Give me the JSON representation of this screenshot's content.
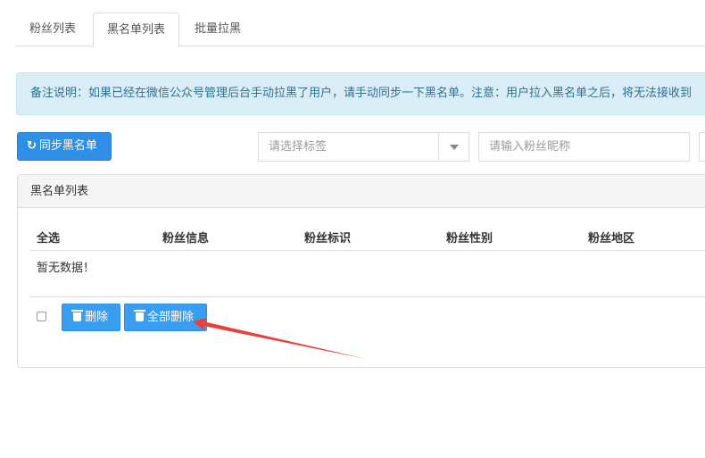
{
  "tabs": [
    {
      "label": "粉丝列表",
      "active": false
    },
    {
      "label": "黑名单列表",
      "active": true
    },
    {
      "label": "批量拉黑",
      "active": false
    }
  ],
  "notice": {
    "text": "备注说明：如果已经在微信公众号管理后台手动拉黑了用户，请手动同步一下黑名单。注意：用户拉入黑名单之后，将无法接收到"
  },
  "toolbar": {
    "sync_icon": "↻",
    "sync_label": "同步黑名单",
    "tag_select_placeholder": "请选择标签",
    "nickname_placeholder": "请输入粉丝昵称"
  },
  "panel": {
    "title": "黑名单列表",
    "columns": [
      "全选",
      "粉丝信息",
      "粉丝标识",
      "粉丝性别",
      "粉丝地区"
    ],
    "empty_text": "暂无数据！",
    "delete_label": "删除",
    "delete_all_label": "全部删除"
  },
  "colors": {
    "primary": "#2f8fe6",
    "notice_bg": "#d9edf7",
    "notice_text": "#31708f",
    "annotation_arrow": "#e8413c"
  }
}
